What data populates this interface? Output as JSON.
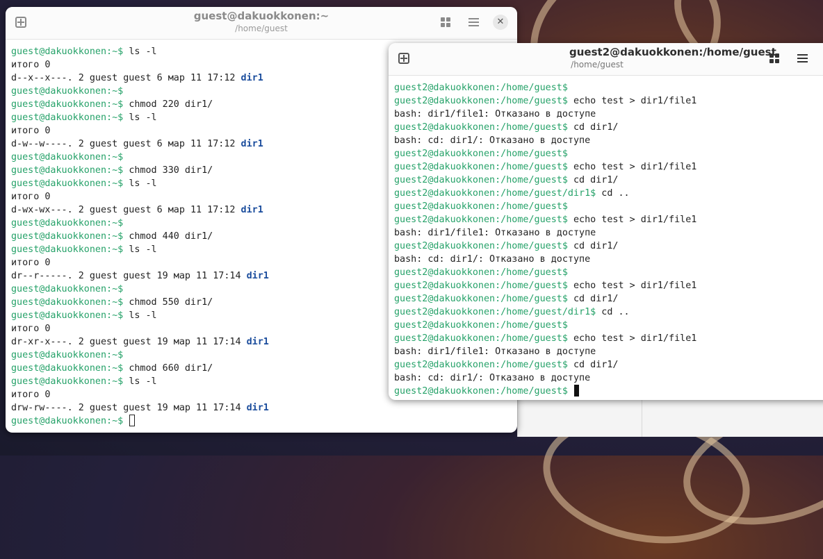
{
  "terminal1": {
    "title": "guest@dakuokkonen:~",
    "subtitle": "/home/guest",
    "lines": [
      {
        "prompt": "guest@dakuokkonen:~$ ",
        "text": "ls -l"
      },
      {
        "text": "итого 0"
      },
      {
        "text": "d--x--x---. 2 guest guest 6 мар 11 17:12 ",
        "dir": "dir1"
      },
      {
        "prompt": "guest@dakuokkonen:~$",
        "text": ""
      },
      {
        "prompt": "guest@dakuokkonen:~$ ",
        "text": "chmod 220 dir1/"
      },
      {
        "prompt": "guest@dakuokkonen:~$ ",
        "text": "ls -l"
      },
      {
        "text": "итого 0"
      },
      {
        "text": "d-w--w----. 2 guest guest 6 мар 11 17:12 ",
        "dir": "dir1"
      },
      {
        "prompt": "guest@dakuokkonen:~$",
        "text": ""
      },
      {
        "prompt": "guest@dakuokkonen:~$ ",
        "text": "chmod 330 dir1/"
      },
      {
        "prompt": "guest@dakuokkonen:~$ ",
        "text": "ls -l"
      },
      {
        "text": "итого 0"
      },
      {
        "text": "d-wx-wx---. 2 guest guest 6 мар 11 17:12 ",
        "dir": "dir1"
      },
      {
        "prompt": "guest@dakuokkonen:~$",
        "text": ""
      },
      {
        "prompt": "guest@dakuokkonen:~$ ",
        "text": "chmod 440 dir1/"
      },
      {
        "prompt": "guest@dakuokkonen:~$ ",
        "text": "ls -l"
      },
      {
        "text": "итого 0"
      },
      {
        "text": "dr--r-----. 2 guest guest 19 мар 11 17:14 ",
        "dir": "dir1"
      },
      {
        "prompt": "guest@dakuokkonen:~$",
        "text": ""
      },
      {
        "prompt": "guest@dakuokkonen:~$ ",
        "text": "chmod 550 dir1/"
      },
      {
        "prompt": "guest@dakuokkonen:~$ ",
        "text": "ls -l"
      },
      {
        "text": "итого 0"
      },
      {
        "text": "dr-xr-x---. 2 guest guest 19 мар 11 17:14 ",
        "dir": "dir1"
      },
      {
        "prompt": "guest@dakuokkonen:~$",
        "text": ""
      },
      {
        "prompt": "guest@dakuokkonen:~$ ",
        "text": "chmod 660 dir1/"
      },
      {
        "prompt": "guest@dakuokkonen:~$ ",
        "text": "ls -l"
      },
      {
        "text": "итого 0"
      },
      {
        "text": "drw-rw----. 2 guest guest 19 мар 11 17:14 ",
        "dir": "dir1"
      },
      {
        "prompt": "guest@dakuokkonen:~$ ",
        "text": "",
        "cursor": "hollow"
      }
    ]
  },
  "terminal2": {
    "title": "guest2@dakuokkonen:/home/guest",
    "subtitle": "/home/guest",
    "lines": [
      {
        "prompt": "guest2@dakuokkonen:/home/guest$",
        "text": ""
      },
      {
        "prompt": "guest2@dakuokkonen:/home/guest$ ",
        "text": "echo test > dir1/file1"
      },
      {
        "text": "bash: dir1/file1: Отказано в доступе"
      },
      {
        "prompt": "guest2@dakuokkonen:/home/guest$ ",
        "text": "cd dir1/"
      },
      {
        "text": "bash: cd: dir1/: Отказано в доступе"
      },
      {
        "prompt": "guest2@dakuokkonen:/home/guest$",
        "text": ""
      },
      {
        "prompt": "guest2@dakuokkonen:/home/guest$ ",
        "text": "echo test > dir1/file1"
      },
      {
        "prompt": "guest2@dakuokkonen:/home/guest$ ",
        "text": "cd dir1/"
      },
      {
        "prompt": "guest2@dakuokkonen:/home/guest/dir1$ ",
        "text": "cd .."
      },
      {
        "prompt": "guest2@dakuokkonen:/home/guest$",
        "text": ""
      },
      {
        "prompt": "guest2@dakuokkonen:/home/guest$ ",
        "text": "echo test > dir1/file1"
      },
      {
        "text": "bash: dir1/file1: Отказано в доступе"
      },
      {
        "prompt": "guest2@dakuokkonen:/home/guest$ ",
        "text": "cd dir1/"
      },
      {
        "text": "bash: cd: dir1/: Отказано в доступе"
      },
      {
        "prompt": "guest2@dakuokkonen:/home/guest$",
        "text": ""
      },
      {
        "prompt": "guest2@dakuokkonen:/home/guest$ ",
        "text": "echo test > dir1/file1"
      },
      {
        "prompt": "guest2@dakuokkonen:/home/guest$ ",
        "text": "cd dir1/"
      },
      {
        "prompt": "guest2@dakuokkonen:/home/guest/dir1$ ",
        "text": "cd .."
      },
      {
        "prompt": "guest2@dakuokkonen:/home/guest$",
        "text": ""
      },
      {
        "prompt": "guest2@dakuokkonen:/home/guest$ ",
        "text": "echo test > dir1/file1"
      },
      {
        "text": "bash: dir1/file1: Отказано в доступе"
      },
      {
        "prompt": "guest2@dakuokkonen:/home/guest$ ",
        "text": "cd dir1/"
      },
      {
        "text": "bash: cd: dir1/: Отказано в доступе"
      },
      {
        "prompt": "guest2@dakuokkonen:/home/guest$ ",
        "text": "",
        "cursor": "solid"
      }
    ]
  },
  "icons": {
    "new_tab": "new-tab-icon",
    "view_tabs": "grid-icon",
    "menu": "hamburger-menu-icon",
    "close": "close-icon"
  },
  "colors": {
    "prompt": "#26a269",
    "directory": "#1a4c9c",
    "text": "#222222",
    "window_bg": "#ffffff",
    "header_bg": "#fbfbfb"
  }
}
